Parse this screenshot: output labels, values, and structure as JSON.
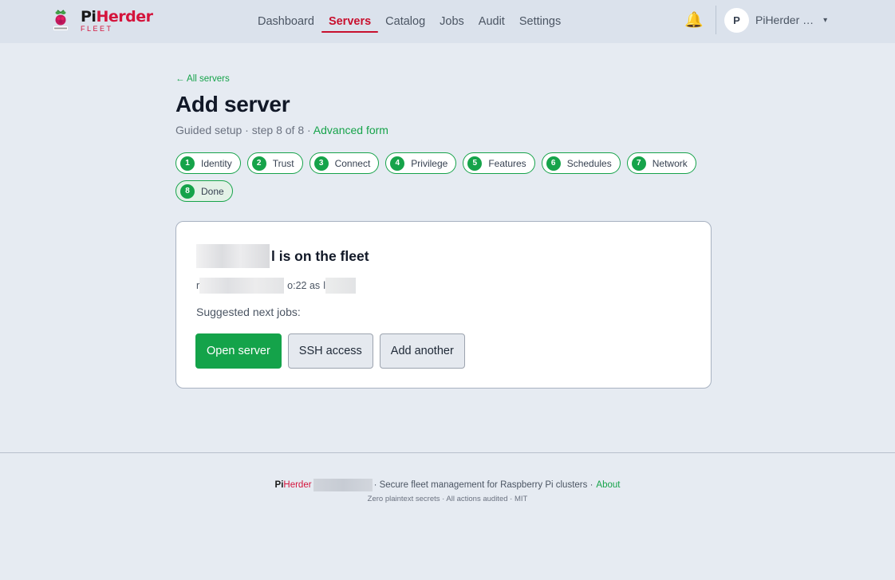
{
  "app": {
    "logo_pi": "Pi",
    "logo_herder": "Herder",
    "logo_sub": "FLEET"
  },
  "nav": {
    "items": [
      {
        "label": "Dashboard",
        "active": false
      },
      {
        "label": "Servers",
        "active": true
      },
      {
        "label": "Catalog",
        "active": false
      },
      {
        "label": "Jobs",
        "active": false
      },
      {
        "label": "Audit",
        "active": false
      },
      {
        "label": "Settings",
        "active": false
      }
    ]
  },
  "header": {
    "bell_icon": "🔔",
    "user_initial": "P",
    "user_name": "PiHerder …",
    "caret": "▾"
  },
  "page": {
    "back_link": "← All servers",
    "title": "Add server",
    "subtitle_prefix": "Guided setup · step 8 of 8 · ",
    "advanced_link": "Advanced form"
  },
  "steps": [
    {
      "num": "1",
      "label": "Identity"
    },
    {
      "num": "2",
      "label": "Trust"
    },
    {
      "num": "3",
      "label": "Connect"
    },
    {
      "num": "4",
      "label": "Privilege"
    },
    {
      "num": "5",
      "label": "Features"
    },
    {
      "num": "6",
      "label": "Schedules"
    },
    {
      "num": "7",
      "label": "Network"
    },
    {
      "num": "8",
      "label": "Done"
    }
  ],
  "card": {
    "heading_suffix": "l is on the fleet",
    "addr_prefix": "r",
    "addr_port": "o:22 as",
    "addr_user_prefix": "l",
    "suggest_label": "Suggested next jobs:",
    "buttons": {
      "open_server": "Open server",
      "ssh_access": "SSH access",
      "add_another": "Add another"
    }
  },
  "footer": {
    "pi": "Pi",
    "herder": "Herder",
    "tagline": "· Secure fleet management for Raspberry Pi clusters ·",
    "about": "About",
    "line2": "Zero plaintext secrets · All actions audited · MIT"
  },
  "colors": {
    "brand_red": "#c8102e",
    "accent_green": "#16a34a",
    "background": "#e6ebf2",
    "topbar": "#dbe2ec"
  }
}
